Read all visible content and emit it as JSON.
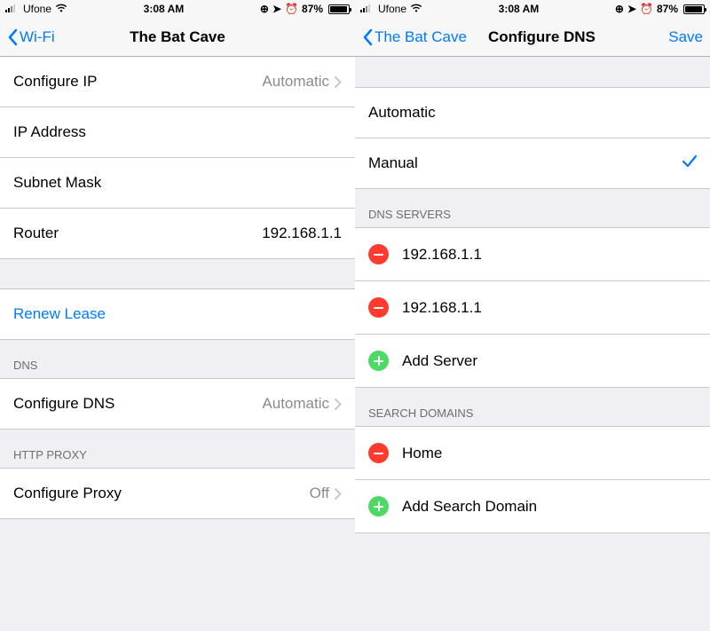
{
  "status": {
    "carrier": "Ufone",
    "time": "3:08 AM",
    "battery_pct": "87%"
  },
  "left": {
    "back_label": "Wi-Fi",
    "title": "The Bat Cave",
    "rows": {
      "configure_ip_label": "Configure IP",
      "configure_ip_value": "Automatic",
      "ip_address_label": "IP Address",
      "subnet_label": "Subnet Mask",
      "router_label": "Router",
      "router_value": "192.168.1.1",
      "renew_lease": "Renew Lease",
      "dns_header": "DNS",
      "configure_dns_label": "Configure DNS",
      "configure_dns_value": "Automatic",
      "proxy_header": "HTTP PROXY",
      "configure_proxy_label": "Configure Proxy",
      "configure_proxy_value": "Off"
    }
  },
  "right": {
    "back_label": "The Bat Cave",
    "title": "Configure DNS",
    "save_label": "Save",
    "automatic": "Automatic",
    "manual": "Manual",
    "dns_header": "DNS SERVERS",
    "servers": [
      "192.168.1.1",
      "192.168.1.1"
    ],
    "add_server": "Add Server",
    "search_header": "SEARCH DOMAINS",
    "domains": [
      "Home"
    ],
    "add_domain": "Add Search Domain"
  }
}
